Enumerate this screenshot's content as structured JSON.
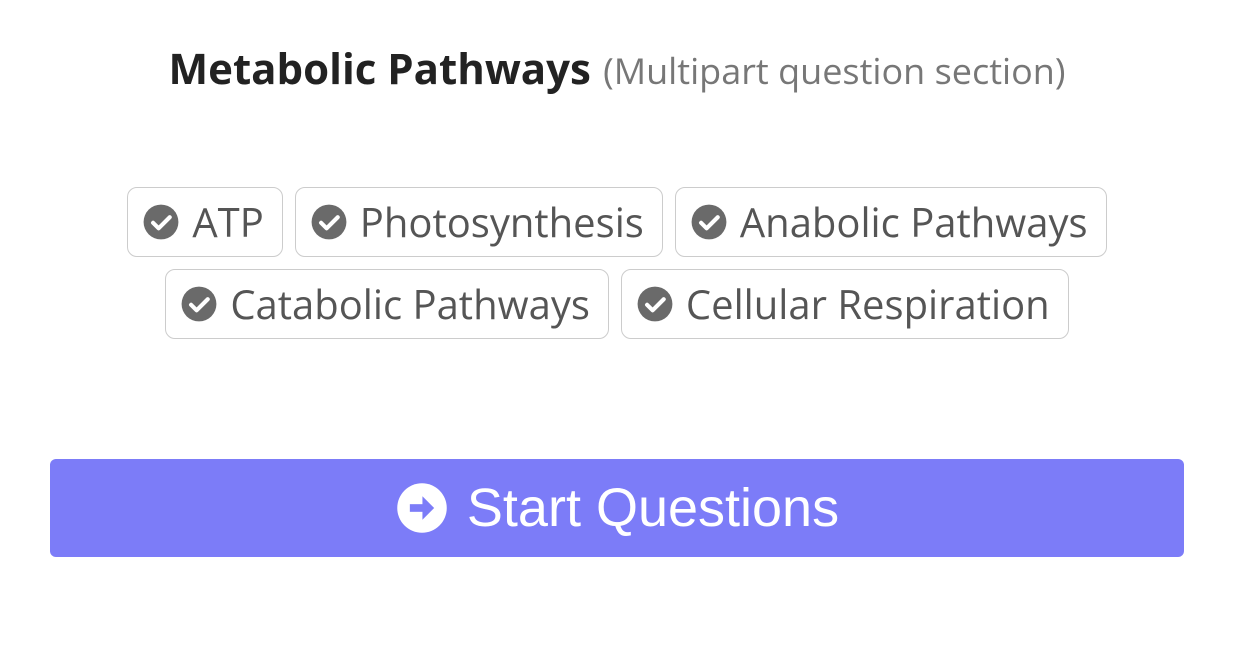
{
  "header": {
    "title": "Metabolic Pathways",
    "subtitle": "(Multipart question section)"
  },
  "tags": [
    {
      "label": "ATP"
    },
    {
      "label": "Photosynthesis"
    },
    {
      "label": "Anabolic Pathways"
    },
    {
      "label": "Catabolic Pathways"
    },
    {
      "label": "Cellular Respiration"
    }
  ],
  "start_button": {
    "label": "Start Questions"
  },
  "colors": {
    "accent": "#7C7CF8",
    "icon_fill": "#6a6a6a"
  }
}
